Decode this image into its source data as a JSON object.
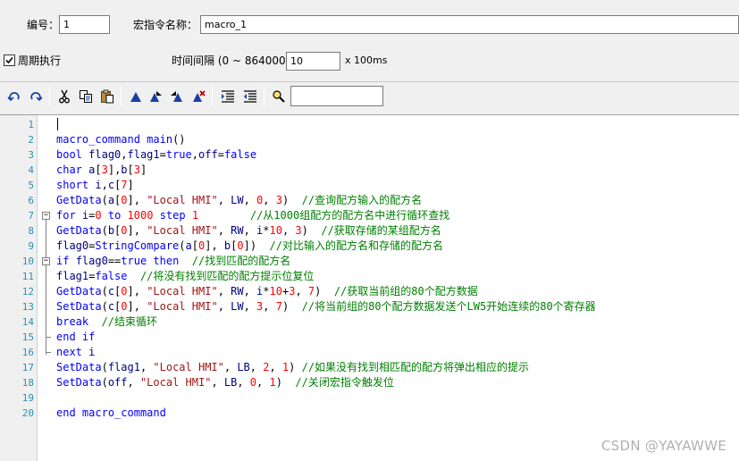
{
  "header": {
    "number_label": "编号：",
    "number_value": "1",
    "macro_name_label": "宏指令名称：",
    "macro_name_value": "macro_1"
  },
  "periodic": {
    "checkbox_label": "周期执行",
    "checked": true,
    "interval_label": "时间间隔 (0 ~ 864000)：",
    "interval_value": "10",
    "interval_unit": "x 100ms"
  },
  "toolbar": {
    "icons": [
      "undo-icon",
      "redo-icon",
      "cut-icon",
      "copy-icon",
      "paste-icon",
      "set-bookmark-icon",
      "next-bookmark-icon",
      "prev-bookmark-icon",
      "clear-bookmarks-icon",
      "indent-icon",
      "outdent-icon",
      "find-icon"
    ],
    "search_value": ""
  },
  "editor": {
    "line_numbers": [
      "1",
      "2",
      "3",
      "4",
      "5",
      "6",
      "7",
      "8",
      "9",
      "10",
      "11",
      "12",
      "13",
      "14",
      "15",
      "16",
      "17",
      "18",
      "19",
      "20"
    ],
    "lines": [
      "",
      "macro_command main()",
      "bool flag0,flag1=true,off=false",
      "char a[3],b[3]",
      "short i,c[7]",
      "GetData(a[0], \"Local HMI\", LW, 0, 3)  //查询配方输入的配方名",
      "for i=0 to 1000 step 1        //从1000组配方的配方名中进行循环查找",
      "GetData(b[0], \"Local HMI\", RW, i*10, 3)  //获取存储的某组配方名",
      "flag0=StringCompare(a[0], b[0])  //对比输入的配方名和存储的配方名",
      "if flag0==true then  //找到匹配的配方名",
      "flag1=false  //将没有找到匹配的配方提示位复位",
      "GetData(c[0], \"Local HMI\", RW, i*10+3, 7)  //获取当前组的80个配方数据",
      "SetData(c[0], \"Local HMI\", LW, 3, 7)  //将当前组的80个配方数据发送个LW5开始连续的80个寄存器",
      "break  //结束循环",
      "end if",
      "next i",
      "SetData(flag1, \"Local HMI\", LB, 2, 1) //如果没有找到相匹配的配方将弹出相应的提示",
      "SetData(off, \"Local HMI\", LB, 0, 1)  //关闭宏指令触发位",
      "",
      "end macro_command"
    ]
  },
  "watermark": "CSDN @YAYAWWE"
}
